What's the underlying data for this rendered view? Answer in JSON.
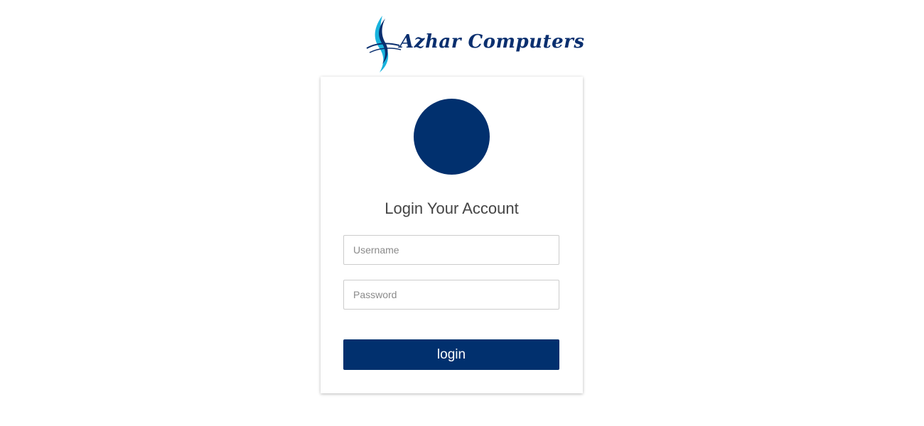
{
  "brand": {
    "name": "Azhar Computers",
    "logo_icon": "swoosh-logo-icon",
    "colors": {
      "primary": "#0a2f6f",
      "accent": "#19b3dd"
    }
  },
  "login_card": {
    "avatar_icon": "user-avatar-circle",
    "avatar_color": "#01306e",
    "title": "Login Your Account",
    "username": {
      "placeholder": "Username",
      "value": ""
    },
    "password": {
      "placeholder": "Password",
      "value": ""
    },
    "submit_label": "login",
    "button_color": "#01306e"
  }
}
